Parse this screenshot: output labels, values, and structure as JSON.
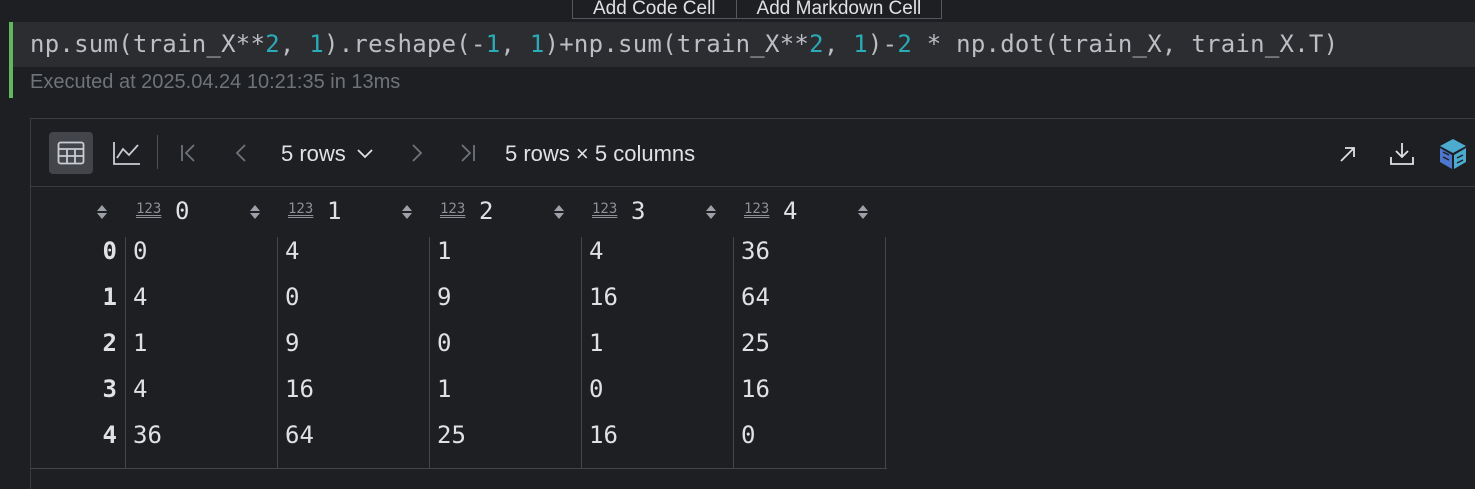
{
  "toolbar_top": {
    "add_code_cell": "Add Code Cell",
    "add_markdown_cell": "Add Markdown Cell"
  },
  "cell": {
    "code_parts": [
      {
        "text": "np.sum(train_X**",
        "kind": "plain"
      },
      {
        "text": "2",
        "kind": "num"
      },
      {
        "text": ", ",
        "kind": "plain"
      },
      {
        "text": "1",
        "kind": "num"
      },
      {
        "text": ").reshape(-",
        "kind": "plain"
      },
      {
        "text": "1",
        "kind": "num"
      },
      {
        "text": ", ",
        "kind": "plain"
      },
      {
        "text": "1",
        "kind": "num"
      },
      {
        "text": ")+np.sum(train_X**",
        "kind": "plain"
      },
      {
        "text": "2",
        "kind": "num"
      },
      {
        "text": ", ",
        "kind": "plain"
      },
      {
        "text": "1",
        "kind": "num"
      },
      {
        "text": ")-",
        "kind": "plain"
      },
      {
        "text": "2",
        "kind": "num"
      },
      {
        "text": " * np.dot(train_X, train_X.T)",
        "kind": "plain"
      }
    ],
    "execution_info": "Executed at 2025.04.24 10:21:35 in 13ms",
    "accent_color": "#5fb85f"
  },
  "output": {
    "toolbar": {
      "table_view_icon": "table-icon",
      "chart_view_icon": "line-chart-icon",
      "first_page_icon": "first-page-icon",
      "prev_page_icon": "prev-page-icon",
      "rows_selector": "5 rows",
      "next_page_icon": "next-page-icon",
      "last_page_icon": "last-page-icon",
      "summary": "5 rows × 5 columns",
      "open_icon": "open-in-new-icon",
      "download_icon": "download-icon",
      "numpy_icon": "numpy-logo-icon"
    },
    "table": {
      "type_badge": "123",
      "columns": [
        "0",
        "1",
        "2",
        "3",
        "4"
      ],
      "row_index": [
        "0",
        "1",
        "2",
        "3",
        "4"
      ],
      "rows": [
        [
          "0",
          "4",
          "1",
          "4",
          "36"
        ],
        [
          "4",
          "0",
          "9",
          "16",
          "64"
        ],
        [
          "1",
          "9",
          "0",
          "1",
          "25"
        ],
        [
          "4",
          "16",
          "1",
          "0",
          "16"
        ],
        [
          "36",
          "64",
          "25",
          "16",
          "0"
        ]
      ]
    }
  }
}
